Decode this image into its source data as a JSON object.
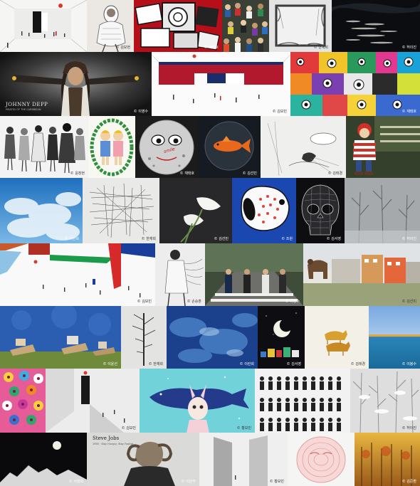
{
  "credits": {
    "r1_t2": "© 김보현",
    "r1_t3": "© 재태호",
    "r1_t5": "© 한재희",
    "r1_t6": "© 허이진",
    "r2_t1": "© 이영수",
    "r2_t2": "© 김보민",
    "r2_t3": "© 재태호",
    "r3_t1": "© 윤창현",
    "r3_t3": "© 재태호",
    "r3_t4": "© 김선민",
    "r3_t5": "© 김태경",
    "r4_t1": "© 이란희",
    "r4_t2": "© 한재희",
    "r4_t4": "© 김선민",
    "r4_t5": "© 조원",
    "r4_t6": "© 김서영",
    "r4_t7": "© 허이진",
    "r5_t1": "© 김보민",
    "r5_t2": "© 손승혼",
    "r5_t3": "© 이영수",
    "r5_t4": "© 김선미",
    "r6_t1": "© 이윤선",
    "r6_t2": "© 한재희",
    "r6_t3": "© 이란희",
    "r6_t4": "© 김서영",
    "r6_t5": "© 김태경",
    "r6_t6": "© 이봉수",
    "r7_t2": "© 김보민",
    "r7_t3": "© 황보민",
    "r7_t6": "© 허이진",
    "r8_t1": "© 서영희",
    "r8_t2": "© 이완주",
    "r8_t3": "© 황보민",
    "r8_t5": "© 김준환"
  },
  "artwork_text": {
    "depp_title": "JOHNNY DEPP",
    "depp_sub": "PIRATES OF THE CARIBBEAN",
    "jobs_name": "Steve  Jobs",
    "jobs_sub": "1955 · Stay Hungry, Stay Foolish",
    "smile_text": "smile"
  }
}
